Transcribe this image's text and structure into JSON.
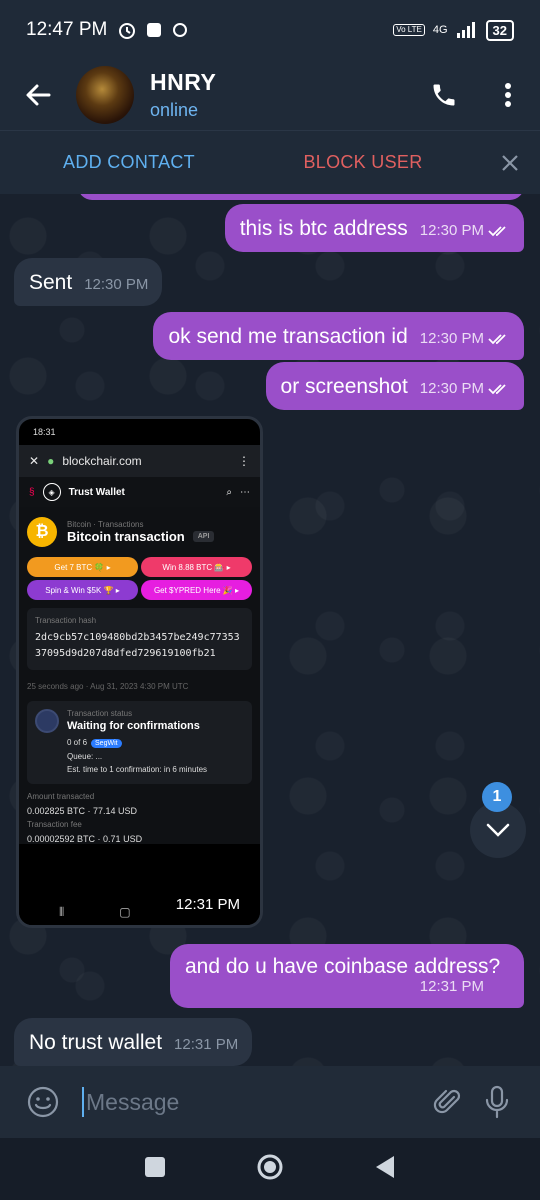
{
  "status_bar": {
    "time": "12:47 PM",
    "network": "4G",
    "volte": "Vo LTE",
    "battery": "32"
  },
  "header": {
    "name": "HNRY",
    "status": "online",
    "icons": [
      "back-arrow-icon",
      "phone-icon",
      "more-vertical-icon"
    ]
  },
  "action_bar": {
    "add_contact": "ADD CONTACT",
    "block_user": "BLOCK USER"
  },
  "messages": [
    {
      "dir": "out",
      "text": "this is btc address",
      "time": "12:30 PM",
      "read": true
    },
    {
      "dir": "in",
      "text": "Sent",
      "time": "12:30 PM"
    },
    {
      "dir": "out",
      "text": "ok send me transaction id",
      "time": "12:30 PM",
      "read": true
    },
    {
      "dir": "out",
      "text": "or screenshot",
      "time": "12:30 PM",
      "read": true
    },
    {
      "dir": "in",
      "type": "image",
      "time": "12:31 PM"
    },
    {
      "dir": "out",
      "text": "and do u have coinbase address?",
      "time": "12:31 PM"
    },
    {
      "dir": "in",
      "text": "No trust wallet",
      "time": "12:31 PM"
    }
  ],
  "screenshot": {
    "status_time": "18:31",
    "url": "blockchair.com",
    "wallet_label": "Trust Wallet",
    "breadcrumb": "Bitcoin · Transactions",
    "title": "Bitcoin transaction",
    "api": "API",
    "ads": [
      {
        "label": "Get 7 BTC 🍀 ▸",
        "color": "#f29a1f"
      },
      {
        "label": "Win 8.88 BTC 🎰 ▸",
        "color": "#ef3a6a"
      },
      {
        "label": "Spin & Win $5K 🏆 ▸",
        "color": "#8d3bd1"
      },
      {
        "label": "Get $YPRED Here 🎉 ▸",
        "color": "#e61ee0"
      }
    ],
    "hash_label": "Transaction hash",
    "hash": "2dc9cb57c109480bd2b3457be249c7735337095d9d207d8dfed729619100fb21",
    "time_ago": "25 seconds ago · Aug 31, 2023 4:30 PM UTC",
    "status_label": "Transaction status",
    "status_title": "Waiting for confirmations",
    "confirmations": "0 of 6",
    "segwit": "SegWit",
    "queue": "Queue: ...",
    "est": "Est. time to 1 confirmation: in 6 minutes",
    "amount_label": "Amount transacted",
    "amount": "0.002825 BTC · 77.14 USD",
    "fee_label": "Transaction fee",
    "fee": "0.00002592 BTC · 0.71 USD"
  },
  "scroll": {
    "unread_count": "1"
  },
  "composer": {
    "placeholder": "Message"
  }
}
